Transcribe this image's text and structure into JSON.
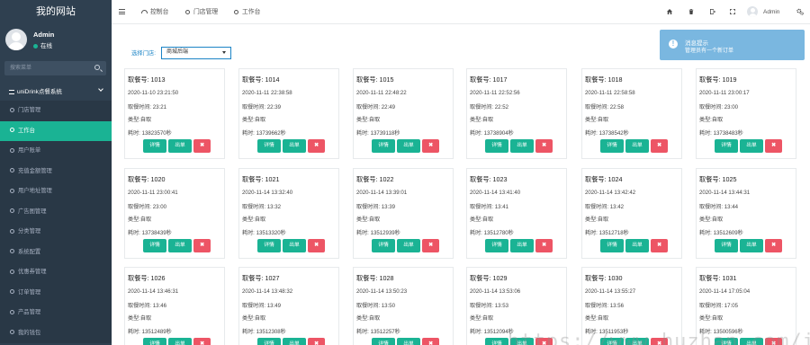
{
  "sidebar": {
    "brand": "我的网站",
    "user": {
      "name": "Admin",
      "status": "在线"
    },
    "search_placeholder": "搜索菜单",
    "section": "uniDrink点餐系统",
    "items": [
      {
        "label": "门店管理",
        "active": false
      },
      {
        "label": "工作台",
        "active": true
      },
      {
        "label": "用户账单",
        "active": false
      },
      {
        "label": "充值金额管理",
        "active": false
      },
      {
        "label": "用户地址管理",
        "active": false
      },
      {
        "label": "广告图管理",
        "active": false
      },
      {
        "label": "分类管理",
        "active": false
      },
      {
        "label": "系统配置",
        "active": false
      },
      {
        "label": "优惠券管理",
        "active": false
      },
      {
        "label": "订单管理",
        "active": false
      },
      {
        "label": "产品管理",
        "active": false
      },
      {
        "label": "我的钱包",
        "active": false
      }
    ]
  },
  "topbar": {
    "tabs": [
      {
        "label": "控制台",
        "icon": "dashboard-icon"
      },
      {
        "label": "门店管理",
        "icon": "circle-icon"
      },
      {
        "label": "工作台",
        "icon": "circle-icon"
      }
    ],
    "right_icons": [
      "home-icon",
      "trash-icon",
      "exit-icon",
      "fullscreen-icon"
    ],
    "user": "Admin",
    "settings_icon": "gears-icon"
  },
  "filter": {
    "label": "选择门店:",
    "selected": "商城后端"
  },
  "toast": {
    "title": "消息提示",
    "message": "管理员有一个新订单",
    "icon": "info-icon"
  },
  "labels": {
    "detail": "详情",
    "serve": "出单",
    "delete": "✖"
  },
  "orders": [
    {
      "no": "取餐号: 1013",
      "created": "2020-11-10 23:21:50",
      "meal_time": "取餐时间: 23:21",
      "type": "类型:自取",
      "elapsed": "耗时: 13823570秒"
    },
    {
      "no": "取餐号: 1014",
      "created": "2020-11-11 22:38:58",
      "meal_time": "取餐时间: 22:39",
      "type": "类型:自取",
      "elapsed": "耗时: 13739662秒"
    },
    {
      "no": "取餐号: 1015",
      "created": "2020-11-11 22:48:22",
      "meal_time": "取餐时间: 22:49",
      "type": "类型:自取",
      "elapsed": "耗时: 13739118秒"
    },
    {
      "no": "取餐号: 1017",
      "created": "2020-11-11 22:52:56",
      "meal_time": "取餐时间: 22:52",
      "type": "类型:自取",
      "elapsed": "耗时: 13738904秒"
    },
    {
      "no": "取餐号: 1018",
      "created": "2020-11-11 22:58:58",
      "meal_time": "取餐时间: 22:58",
      "type": "类型:自取",
      "elapsed": "耗时: 13738542秒"
    },
    {
      "no": "取餐号: 1019",
      "created": "2020-11-11 23:00:17",
      "meal_time": "取餐时间: 23:00",
      "type": "类型:自取",
      "elapsed": "耗时: 13738483秒"
    },
    {
      "no": "取餐号: 1020",
      "created": "2020-11-11 23:00:41",
      "meal_time": "取餐时间: 23:00",
      "type": "类型:自取",
      "elapsed": "耗时: 13738439秒"
    },
    {
      "no": "取餐号: 1021",
      "created": "2020-11-14 13:32:40",
      "meal_time": "取餐时间: 13:32",
      "type": "类型:自取",
      "elapsed": "耗时: 13513320秒"
    },
    {
      "no": "取餐号: 1022",
      "created": "2020-11-14 13:39:01",
      "meal_time": "取餐时间: 13:39",
      "type": "类型:自取",
      "elapsed": "耗时: 13512939秒"
    },
    {
      "no": "取餐号: 1023",
      "created": "2020-11-14 13:41:40",
      "meal_time": "取餐时间: 13:41",
      "type": "类型:自取",
      "elapsed": "耗时: 13512780秒"
    },
    {
      "no": "取餐号: 1024",
      "created": "2020-11-14 13:42:42",
      "meal_time": "取餐时间: 13:42",
      "type": "类型:自取",
      "elapsed": "耗时: 13512718秒"
    },
    {
      "no": "取餐号: 1025",
      "created": "2020-11-14 13:44:31",
      "meal_time": "取餐时间: 13:44",
      "type": "类型:自取",
      "elapsed": "耗时: 13512609秒"
    },
    {
      "no": "取餐号: 1026",
      "created": "2020-11-14 13:46:31",
      "meal_time": "取餐时间: 13:46",
      "type": "类型:自取",
      "elapsed": "耗时: 13512489秒"
    },
    {
      "no": "取餐号: 1027",
      "created": "2020-11-14 13:48:32",
      "meal_time": "取餐时间: 13:49",
      "type": "类型:自取",
      "elapsed": "耗时: 13512308秒"
    },
    {
      "no": "取餐号: 1028",
      "created": "2020-11-14 13:50:23",
      "meal_time": "取餐时间: 13:50",
      "type": "类型:自取",
      "elapsed": "耗时: 13512257秒"
    },
    {
      "no": "取餐号: 1029",
      "created": "2020-11-14 13:53:06",
      "meal_time": "取餐时间: 13:53",
      "type": "类型:自取",
      "elapsed": "耗时: 13512094秒"
    },
    {
      "no": "取餐号: 1030",
      "created": "2020-11-14 13:55:27",
      "meal_time": "取餐时间: 13:56",
      "type": "类型:自取",
      "elapsed": "耗时: 13511953秒"
    },
    {
      "no": "取餐号: 1031",
      "created": "2020-11-14 17:05:04",
      "meal_time": "取餐时间: 17:05",
      "type": "类型:自取",
      "elapsed": "耗时: 13500596秒"
    }
  ],
  "watermark": "https://www.huzhan.com/ishop42421",
  "colors": {
    "sidebar": "#2f4050",
    "accent": "#1ab394",
    "danger": "#ed5565",
    "info": "#1c84c6"
  }
}
